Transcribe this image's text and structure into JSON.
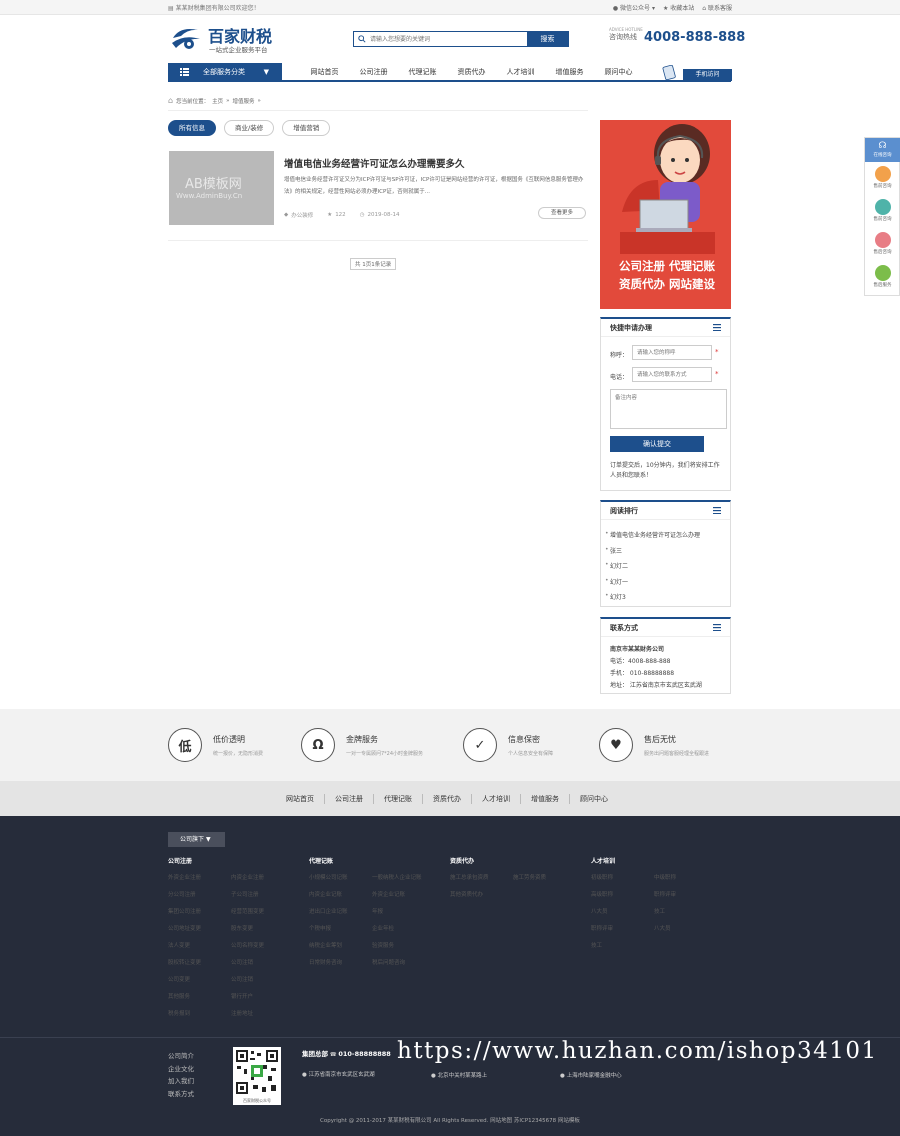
{
  "topbar": {
    "welcome": "某某财税集团有限公司欢迎您！",
    "links": [
      "微信公众号",
      "收藏本站",
      "联系客服"
    ]
  },
  "brand": {
    "name": "百家财税",
    "slogan": "一站式企业服务平台"
  },
  "search": {
    "placeholder": "请输入您想要的关键词",
    "button": "搜索"
  },
  "hotline": {
    "en": "ADVICE HOTLINE",
    "label": "咨询热线",
    "number": "4008-888-888"
  },
  "nav": {
    "all_label": "全部服务分类",
    "items": [
      "网站首页",
      "公司注册",
      "代理记账",
      "资质代办",
      "人才培训",
      "增值服务",
      "顾问中心"
    ],
    "mobile": "手机访问"
  },
  "breadcrumb": {
    "prefix": "您当前位置：",
    "home": "主页",
    "sep": "»",
    "current": "增值服务",
    "tail": "»"
  },
  "tabs": [
    "所有信息",
    "商业/装修",
    "增值营销"
  ],
  "post": {
    "img_line1": "AB模板网",
    "img_line2": "Www.AdminBuy.Cn",
    "title": "增值电信业务经营许可证怎么办理需要多久",
    "excerpt": "增值电信业务经营许可证又分为ICP许可证与SP许可证，ICP许可证是网站经营的许可证，根据国务《互联网信息服务管理办法》的相关规定，经营性网站必须办理ICP证，否则就属于...",
    "author": "办公装修",
    "views": "122",
    "date": "2019-08-14",
    "more": "查看更多"
  },
  "pager": "共 1页1条记录",
  "banner": {
    "line1": "公司注册  代理记账",
    "line2": "资质代办  网站建设"
  },
  "quick": {
    "title": "快捷申请办理",
    "name_label": "称呼：",
    "name_placeholder": "请输入您的称呼",
    "phone_label": "电话：",
    "phone_placeholder": "请输入您的联系方式",
    "note_placeholder": "备注内容",
    "submit": "确认提交",
    "tip": "订单提交后，10分钟内，我们将安排工作人员和您联系！"
  },
  "ranking": {
    "title": "阅读排行",
    "items": [
      "增值电信业务经营许可证怎么办理",
      "张三",
      "幻灯二",
      "幻灯一",
      "幻灯3"
    ]
  },
  "contact": {
    "title": "联系方式",
    "company": "南京市某某财务公司",
    "phone": "电话：4008-888-888",
    "mobile": "手机： 010-88888888",
    "address": "地址： 江苏省南京市玄武区玄武湖"
  },
  "float": {
    "top": "在线咨询",
    "items": [
      "售前咨询",
      "售前咨询",
      "售后咨询",
      "售后服务"
    ]
  },
  "features": [
    {
      "icon": "低",
      "title": "低价透明",
      "desc": "统一报价，无隐形消费"
    },
    {
      "icon": "Ω",
      "title": "金牌服务",
      "desc": "一对一专属顾问7*24小时金牌服务"
    },
    {
      "icon": "✓",
      "title": "信息保密",
      "desc": "个人信息安全有保障"
    },
    {
      "icon": "♥",
      "title": "售后无忧",
      "desc": "服务出问题客服经理全程跟进"
    }
  ],
  "midnav": [
    "网站首页",
    "公司注册",
    "代理记账",
    "资质代办",
    "人才培训",
    "增值服务",
    "顾问中心"
  ],
  "footer": {
    "button": "公司旗下",
    "cols": [
      {
        "title": "公司注册",
        "items": [
          "外资企业注册",
          "内资企业注册",
          "分公司注册",
          "子公司注册",
          "集团公司注册",
          "经营范围变更",
          "公司地址变更",
          "股东变更",
          "法人变更",
          "公司名称变更",
          "股权转让变更",
          "公司注销",
          "公司变更",
          "公司注销",
          "其他服务",
          "银行开户",
          "税务报到",
          "注册地址"
        ]
      },
      {
        "title": "代理记账",
        "items": [
          "小规模公司记账",
          "一般纳税人企业记账",
          "内资企业记账",
          "外资企业记账",
          "进出口企业记账",
          "年报",
          "个税申报",
          "企业年检",
          "纳税企业筹划",
          "验资服务",
          "日常财务咨询",
          "税后问题咨询"
        ]
      },
      {
        "title": "资质代办",
        "items": [
          "施工总承包资质",
          "施工劳务资质",
          "其他资质代办"
        ]
      },
      {
        "title": "人才培训",
        "items": [
          "初级职称",
          "中级职称",
          "高级职称",
          "职称评审",
          "八大员",
          "技工",
          "职称评审",
          "八大员",
          "技工"
        ]
      }
    ],
    "links": [
      "公司简介",
      "企业文化",
      "加入我们",
      "联系方式"
    ],
    "qr_caption": "百家财税公众号",
    "hq_label": "集团总部",
    "hq_phone": "010-88888888",
    "address1": "江苏省南京市玄武区玄武湖",
    "address2": "北京中关村某某路上",
    "address3": "上海市陆家嘴金融中心",
    "copyright": "Copyright @ 2011-2017 某某财税有限公司 All Rights Reserved.    网站地图    苏ICP12345678    网站模板"
  },
  "watermark": "https://www.huzhan.com/ishop34101",
  "colors": {
    "brand": "#1d4f8c",
    "banner": "#e24a3b",
    "footer": "#262c3a"
  }
}
